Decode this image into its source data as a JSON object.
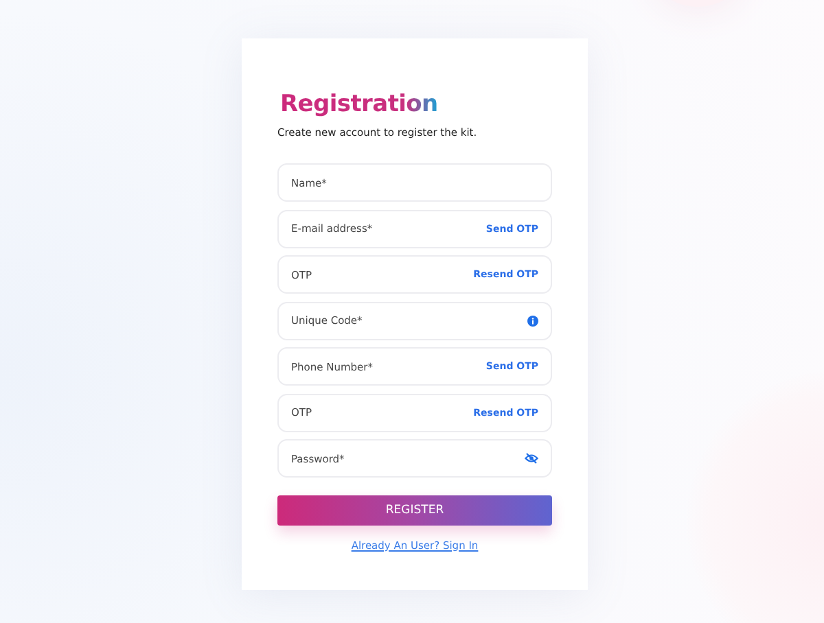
{
  "title": "Registration",
  "subtitle": "Create new account to register the kit.",
  "fields": [
    {
      "placeholder": "Name*",
      "kind": "plain"
    },
    {
      "placeholder": "E-mail address*",
      "kind": "action",
      "action": "Send OTP"
    },
    {
      "placeholder": "OTP",
      "kind": "action",
      "action": "Resend OTP"
    },
    {
      "placeholder": "Unique Code*",
      "kind": "info"
    },
    {
      "placeholder": "Phone Number*",
      "kind": "action",
      "action": "Send OTP"
    },
    {
      "placeholder": "OTP",
      "kind": "action",
      "action": "Resend OTP"
    },
    {
      "placeholder": "Password*",
      "kind": "password"
    }
  ],
  "submit": "REGISTER",
  "signin_link": "Already An User? Sign In"
}
